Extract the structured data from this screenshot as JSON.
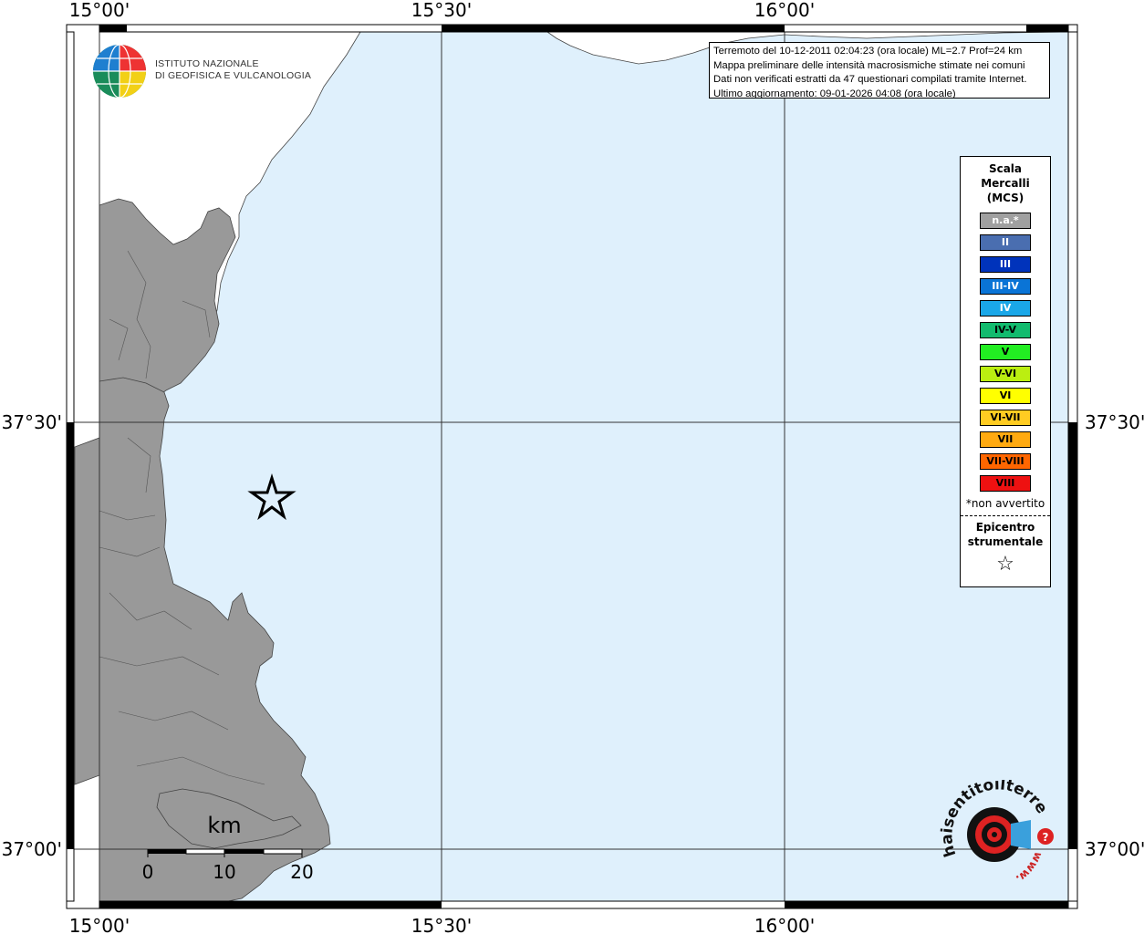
{
  "axes": {
    "lon_labels": [
      "15°00'",
      "15°30'",
      "16°00'"
    ],
    "lat_labels": [
      "37°30'",
      "37°00'"
    ]
  },
  "info": {
    "lines": [
      "Terremoto del 10-12-2011 02:04:23 (ora locale) ML=2.7 Prof=24 km",
      "Mappa preliminare delle intensità macrosismiche stimate nei comuni",
      "Dati non verificati estratti da 47 questionari compilati tramite Internet.",
      "Ultimo aggiornamento: 09-01-2026 04:08 (ora locale)"
    ]
  },
  "institute": {
    "line1": "ISTITUTO NAZIONALE",
    "line2": "DI GEOFISICA E VULCANOLOGIA"
  },
  "legend": {
    "title": [
      "Scala",
      "Mercalli",
      "(MCS)"
    ],
    "items": [
      {
        "label": "n.a.*",
        "color": "#a0a0a0"
      },
      {
        "label": "II",
        "color": "#4a6eb0"
      },
      {
        "label": "III",
        "color": "#0033bb"
      },
      {
        "label": "III-IV",
        "color": "#0a74d6"
      },
      {
        "label": "IV",
        "color": "#1aa7e8"
      },
      {
        "label": "IV-V",
        "color": "#12bb6e"
      },
      {
        "label": "V",
        "color": "#22ee22"
      },
      {
        "label": "V-VI",
        "color": "#bbee11"
      },
      {
        "label": "VI",
        "color": "#ffff00"
      },
      {
        "label": "VI-VII",
        "color": "#ffcc22"
      },
      {
        "label": "VII",
        "color": "#ffaa11"
      },
      {
        "label": "VII-VIII",
        "color": "#ff6600"
      },
      {
        "label": "VIII",
        "color": "#ee1111"
      }
    ],
    "note": "*non avvertito",
    "epicenter": [
      "Epicentro",
      "strumentale"
    ]
  },
  "scale_bar": {
    "unit": "km",
    "ticks": [
      "0",
      "10",
      "20"
    ]
  },
  "logo_hst": {
    "text": "haisentitoilterremoto.it",
    "prefix": "www."
  },
  "colors": {
    "sea": "#dff0fc",
    "land_italy": "#999999",
    "land_outside": "#ffffff"
  }
}
